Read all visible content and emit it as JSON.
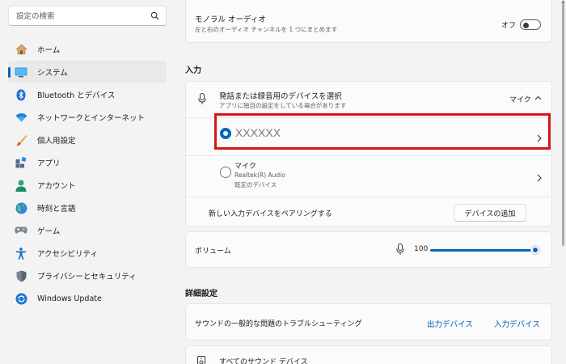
{
  "search": {
    "placeholder": "設定の検索"
  },
  "sidebar": {
    "items": [
      {
        "label": "ホーム",
        "icon": "home-icon"
      },
      {
        "label": "システム",
        "icon": "system-icon",
        "active": true
      },
      {
        "label": "Bluetooth とデバイス",
        "icon": "bluetooth-icon"
      },
      {
        "label": "ネットワークとインターネット",
        "icon": "wifi-icon"
      },
      {
        "label": "個人用設定",
        "icon": "brush-icon"
      },
      {
        "label": "アプリ",
        "icon": "apps-icon"
      },
      {
        "label": "アカウント",
        "icon": "account-icon"
      },
      {
        "label": "時刻と言語",
        "icon": "globe-icon"
      },
      {
        "label": "ゲーム",
        "icon": "gamepad-icon"
      },
      {
        "label": "アクセシビリティ",
        "icon": "accessibility-icon"
      },
      {
        "label": "プライバシーとセキュリティ",
        "icon": "shield-icon"
      },
      {
        "label": "Windows Update",
        "icon": "update-icon"
      }
    ]
  },
  "mono_audio": {
    "title": "モノラル オーディオ",
    "description": "左と右のオーディオ チャンネルを 1 つにまとめます",
    "state": "オフ"
  },
  "input_section": {
    "heading": "入力",
    "select_device": {
      "title": "発話または録音用のデバイスを選択",
      "description": "アプリに独自の設定をしている場合があります",
      "value": "マイク"
    },
    "devices": [
      {
        "name": "XXXXXX",
        "selected": true
      },
      {
        "name": "マイク",
        "detail": "Realtek(R) Audio",
        "status": "既定のデバイス",
        "selected": false
      }
    ],
    "pair": {
      "label": "新しい入力デバイスをペアリングする",
      "button": "デバイスの追加"
    },
    "volume": {
      "label": "ボリューム",
      "value": "100",
      "level": 1.0
    }
  },
  "advanced": {
    "heading": "詳細設定",
    "troubleshoot": {
      "label": "サウンドの一般的な問題のトラブルシューティング",
      "output_link": "出力デバイス",
      "input_link": "入力デバイス"
    },
    "all_devices": {
      "label": "すべてのサウンド デバイス"
    }
  },
  "colors": {
    "accent": "#0067c0",
    "highlight": "#d4161c"
  }
}
